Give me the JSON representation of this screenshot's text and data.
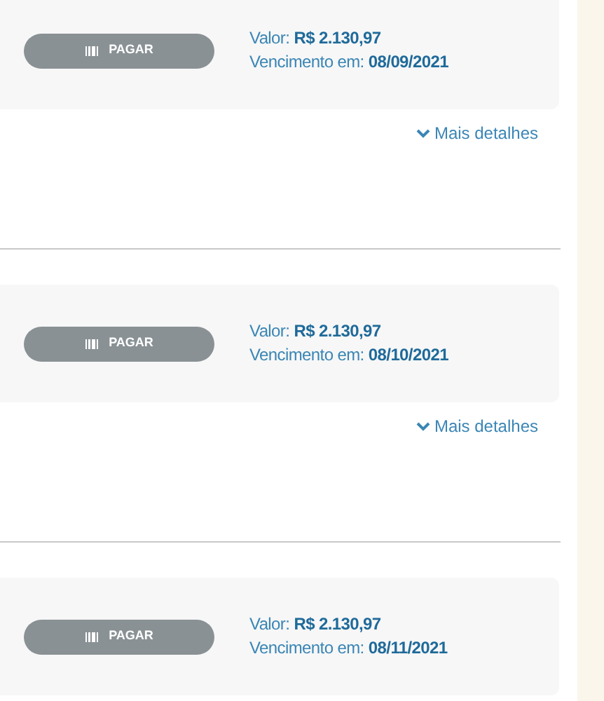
{
  "bills": [
    {
      "button": "PAGAR",
      "value_label": "Valor:",
      "value": "R$ 2.130,97",
      "due_label": "Vencimento em:",
      "due": "08/09/2021",
      "details": "Mais detalhes"
    },
    {
      "button": "PAGAR",
      "value_label": "Valor:",
      "value": "R$ 2.130,97",
      "due_label": "Vencimento em:",
      "due": "08/10/2021",
      "details": "Mais detalhes"
    },
    {
      "button": "PAGAR",
      "value_label": "Valor:",
      "value": "R$ 2.130,97",
      "due_label": "Vencimento em:",
      "due": "08/11/2021"
    }
  ]
}
